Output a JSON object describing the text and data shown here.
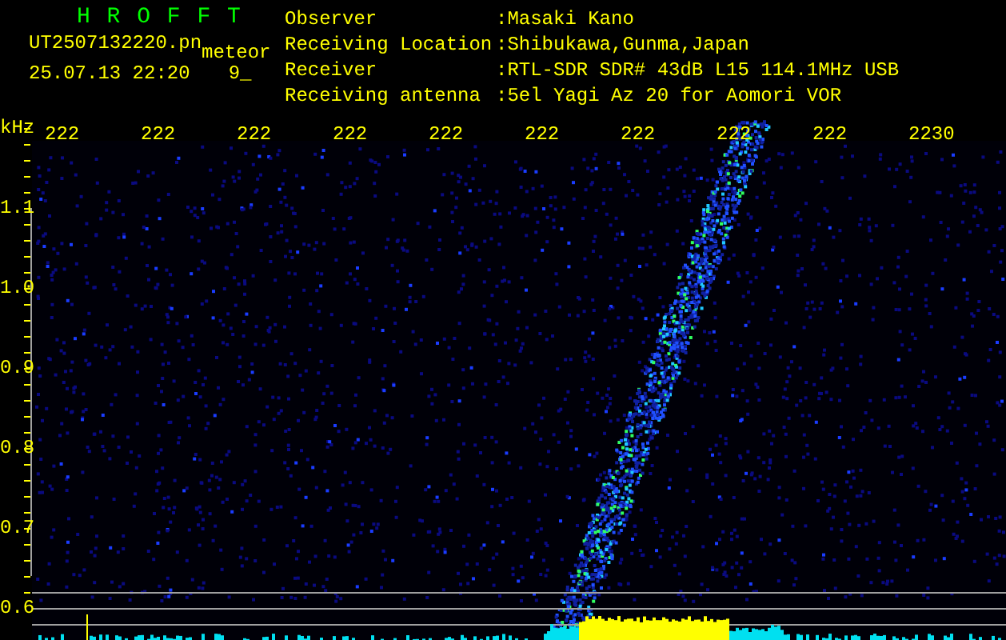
{
  "header": {
    "app_title": "H R O F F T",
    "file_name": "UT2507132220.pn",
    "event_type": "meteor",
    "timestamp": "25.07.13 22:20",
    "count": "9_"
  },
  "station_info": [
    {
      "label": "Observer",
      "value": ":Masaki Kano"
    },
    {
      "label": "Receiving Location",
      "value": ":Shibukawa,Gunma,Japan"
    },
    {
      "label": "Receiver",
      "value": ":RTL-SDR SDR# 43dB L15 114.1MHz USB"
    },
    {
      "label": "Receiving antenna",
      "value": ":5el Yagi Az 20 for Aomori VOR"
    }
  ],
  "spectrogram": {
    "y_unit": "kHz",
    "time_labels": [
      "222",
      "222",
      "222",
      "222",
      "222",
      "222",
      "222",
      "222",
      "222",
      "2230"
    ],
    "freq_labels": [
      "1.1",
      "1.0",
      "0.9",
      "0.8",
      "0.7",
      "0.6"
    ]
  }
}
